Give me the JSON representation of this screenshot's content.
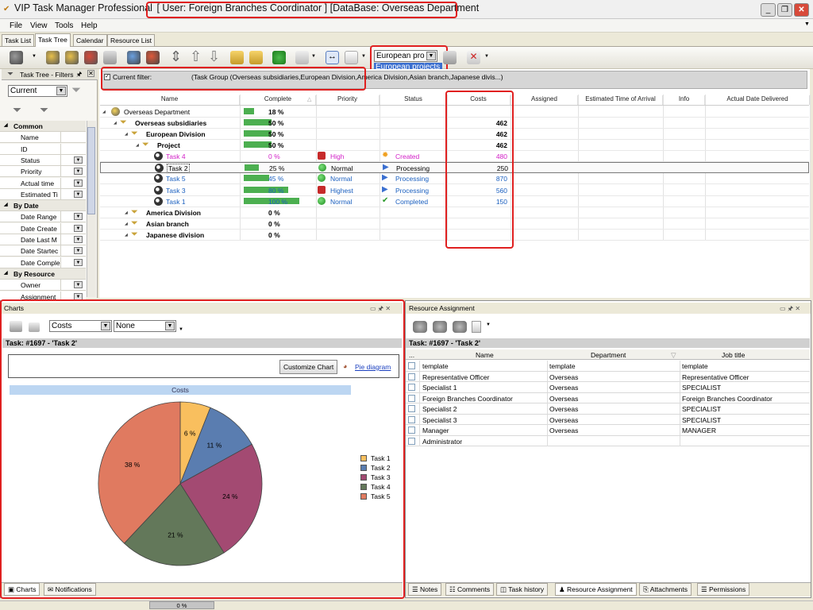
{
  "window": {
    "title_app": "VIP Task Manager Professional",
    "title_user": "[ User: Foreign Branches Coordinator ]",
    "title_db": "[DataBase: Overseas Department",
    "colors": {
      "highlight_box": "#e02020",
      "progress_green": "#4caf50",
      "link_blue": "#1a5fbf",
      "magenta": "#d21ec7"
    }
  },
  "menu": [
    "File",
    "View",
    "Tools",
    "Help"
  ],
  "view_tabs": [
    "Task List",
    "Task Tree",
    "Calendar",
    "Resource List"
  ],
  "toolbar": {
    "project_filter_value": "European pro",
    "project_filter_option": "European projects"
  },
  "left_panel": {
    "title": "Task Tree - Filters",
    "mode_value": "Current",
    "groups": [
      {
        "label": "Common",
        "items": [
          "Name",
          "ID",
          "Status",
          "Priority",
          "Actual time",
          "Estimated Ti"
        ]
      },
      {
        "label": "By Date",
        "items": [
          "Date Range",
          "Date Create",
          "Date Last M",
          "Date Startec",
          "Date Comple"
        ]
      },
      {
        "label": "By Resource",
        "items": [
          "Owner",
          "Assignment"
        ]
      }
    ]
  },
  "filter": {
    "label": "Current filter:",
    "value": "(Task Group  (Overseas subsidiaries,European Division,America Division,Asian branch,Japanese divis...)"
  },
  "grid": {
    "columns": [
      "Name",
      "Complete",
      "Priority",
      "Status",
      "Costs",
      "Assigned",
      "Estimated Time of Arrival",
      "Info",
      "Actual Date Delivered"
    ],
    "rows": [
      {
        "name": "Overseas Department",
        "complete": "18 %",
        "pct": 18,
        "priority": "",
        "status": "",
        "costs": "",
        "level": 0,
        "kind": "dept",
        "bold": false
      },
      {
        "name": "Overseas subsidiaries",
        "complete": "50 %",
        "pct": 50,
        "priority": "",
        "status": "",
        "costs": "462",
        "level": 1,
        "kind": "group",
        "bold": true
      },
      {
        "name": "European Division",
        "complete": "50 %",
        "pct": 50,
        "priority": "",
        "status": "",
        "costs": "462",
        "level": 2,
        "kind": "group",
        "bold": true
      },
      {
        "name": "Project",
        "complete": "50 %",
        "pct": 50,
        "priority": "",
        "status": "",
        "costs": "462",
        "level": 3,
        "kind": "group",
        "bold": true
      },
      {
        "name": "Task 4",
        "complete": "0 %",
        "pct": 0,
        "priority": "High",
        "status": "Created",
        "costs": "480",
        "level": 4,
        "kind": "task",
        "color": "#d21ec7",
        "pri_icon": "high",
        "status_icon": "created"
      },
      {
        "name": "Task 2",
        "complete": "25 %",
        "pct": 25,
        "priority": "Normal",
        "status": "Processing",
        "costs": "250",
        "level": 4,
        "kind": "task",
        "color": "#000000",
        "pri_icon": "normal",
        "status_icon": "processing",
        "selected": true
      },
      {
        "name": "Task 5",
        "complete": "45 %",
        "pct": 45,
        "priority": "Normal",
        "status": "Processing",
        "costs": "870",
        "level": 4,
        "kind": "task",
        "color": "#1a5fbf",
        "pri_icon": "normal",
        "status_icon": "processing"
      },
      {
        "name": "Task 3",
        "complete": "80 %",
        "pct": 80,
        "priority": "Highest",
        "status": "Processing",
        "costs": "560",
        "level": 4,
        "kind": "task",
        "color": "#1a5fbf",
        "pri_icon": "high",
        "status_icon": "processing"
      },
      {
        "name": "Task 1",
        "complete": "100 %",
        "pct": 100,
        "priority": "Normal",
        "status": "Completed",
        "costs": "150",
        "level": 4,
        "kind": "task",
        "color": "#1a5fbf",
        "pri_icon": "normal",
        "status_icon": "completed"
      },
      {
        "name": "America Division",
        "complete": "0 %",
        "pct": 0,
        "priority": "",
        "status": "",
        "costs": "",
        "level": 2,
        "kind": "group",
        "bold": true
      },
      {
        "name": "Asian branch",
        "complete": "0 %",
        "pct": 0,
        "priority": "",
        "status": "",
        "costs": "",
        "level": 2,
        "kind": "group",
        "bold": true
      },
      {
        "name": "Japanese division",
        "complete": "0 %",
        "pct": 0,
        "priority": "",
        "status": "",
        "costs": "",
        "level": 2,
        "kind": "group",
        "bold": true
      }
    ]
  },
  "charts_panel": {
    "title": "Charts",
    "field_value": "Costs",
    "second_value": "None",
    "task_header": "Task: #1697 - 'Task 2'",
    "customize_button": "Customize Chart",
    "pie_link": "Pie diagram",
    "tabs": [
      "Charts",
      "Notifications"
    ]
  },
  "chart_data": {
    "type": "pie",
    "title": "Costs",
    "labels": [
      "Task 1",
      "Task 2",
      "Task 3",
      "Task 4",
      "Task 5"
    ],
    "values": [
      6,
      11,
      24,
      21,
      38
    ],
    "display": [
      "6 %",
      "11 %",
      "24 %",
      "21 %",
      "38 %"
    ],
    "colors": [
      "#f9bf5e",
      "#5a7db0",
      "#a34a72",
      "#63785a",
      "#e07a60"
    ],
    "legend_position": "right"
  },
  "resource_panel": {
    "title": "Resource Assignment",
    "task_header": "Task: #1697 - 'Task 2'",
    "columns": [
      "...",
      "Name",
      "Department",
      "Job title"
    ],
    "rows": [
      {
        "name": "template",
        "department": "template",
        "job": "template"
      },
      {
        "name": "Representative Officer",
        "department": "Overseas",
        "job": "Representative Officer"
      },
      {
        "name": "Specialist 1",
        "department": "Overseas",
        "job": "SPECIALIST"
      },
      {
        "name": "Foreign Branches Coordinator",
        "department": "Overseas",
        "job": "Foreign Branches Coordinator"
      },
      {
        "name": "Specialist 2",
        "department": "Overseas",
        "job": "SPECIALIST"
      },
      {
        "name": "Specialist 3",
        "department": "Overseas",
        "job": "SPECIALIST"
      },
      {
        "name": "Manager",
        "department": "Overseas",
        "job": "MANAGER"
      },
      {
        "name": "Administrator",
        "department": "",
        "job": ""
      }
    ],
    "tabs": [
      "Notes",
      "Comments",
      "Task history",
      "Resource Assignment",
      "Attachments",
      "Permissions"
    ]
  },
  "status_bar": {
    "progress": "0 %"
  }
}
